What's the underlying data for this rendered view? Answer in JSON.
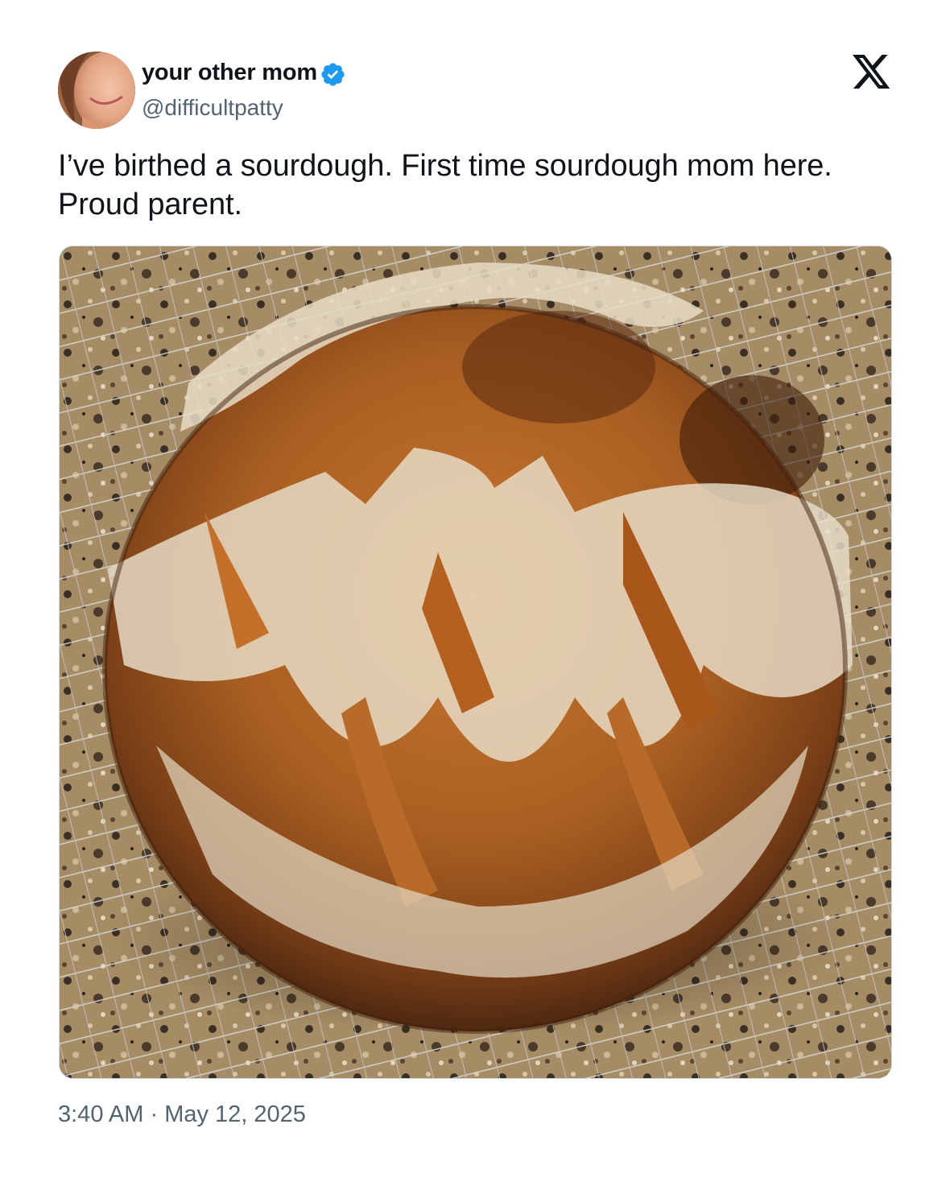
{
  "tweet": {
    "author": {
      "display_name": "your other mom",
      "handle": "@difficultpatty",
      "verified": true,
      "avatar_icon": "avatar-photo"
    },
    "brand_icon": "x-logo-icon",
    "text_lines": [
      "I’ve birthed a sourdough. First time sourdough mom here.",
      "Proud parent."
    ],
    "media": {
      "kind": "photo",
      "subject_icon": "sourdough-loaf-photo"
    },
    "time": "3:40 AM",
    "separator": "·",
    "date": "May 12, 2025"
  },
  "colors": {
    "text_primary": "#0f1419",
    "text_secondary": "#536471",
    "verified_blue": "#1d9bf0",
    "border": "#cfd9de"
  }
}
